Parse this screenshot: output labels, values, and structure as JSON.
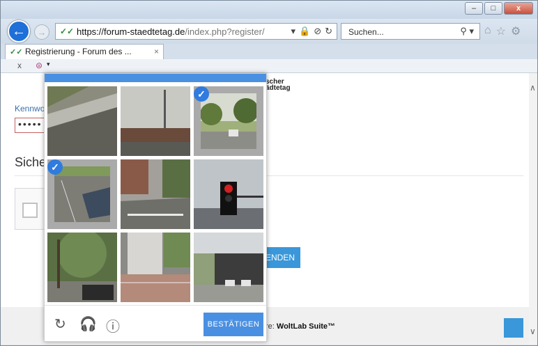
{
  "browser": {
    "url_host": "https://forum-staedtetag.de",
    "url_path": "/index.php?register/",
    "search_placeholder": "Suchen...",
    "tab_title": "Registrierung - Forum des ...",
    "tab_close": "×",
    "minimize": "–",
    "maximize": "□",
    "close": "x",
    "back_symbol": "←",
    "forward_symbol": "→",
    "cmd_close": "x",
    "url_dropdown": "▾",
    "search_dropdown": "▾",
    "cmd_dropdown": "▾",
    "tab_logo": "✓✓",
    "addr_logo": "✓✓"
  },
  "page": {
    "brand_line1": "scher",
    "brand_line2": "ädtetag",
    "password_label": "Kennwo",
    "password_value": "•••••",
    "section_title": "Siche",
    "send_button_partial": "ENDEN",
    "powered_prefix": "re: ",
    "powered_brand": "WoltLab Suite™"
  },
  "captcha": {
    "confirm_label": "BESTÄTIGEN",
    "reload_icon": "↻",
    "audio_icon": "🎧",
    "info_icon": "ⓘ",
    "check_mark": "✓",
    "selected_tiles": [
      2,
      3
    ]
  },
  "colors": {
    "accent": "#4a90e2",
    "browser_back": "#1e6fd8",
    "site_button": "#3a97d9"
  }
}
